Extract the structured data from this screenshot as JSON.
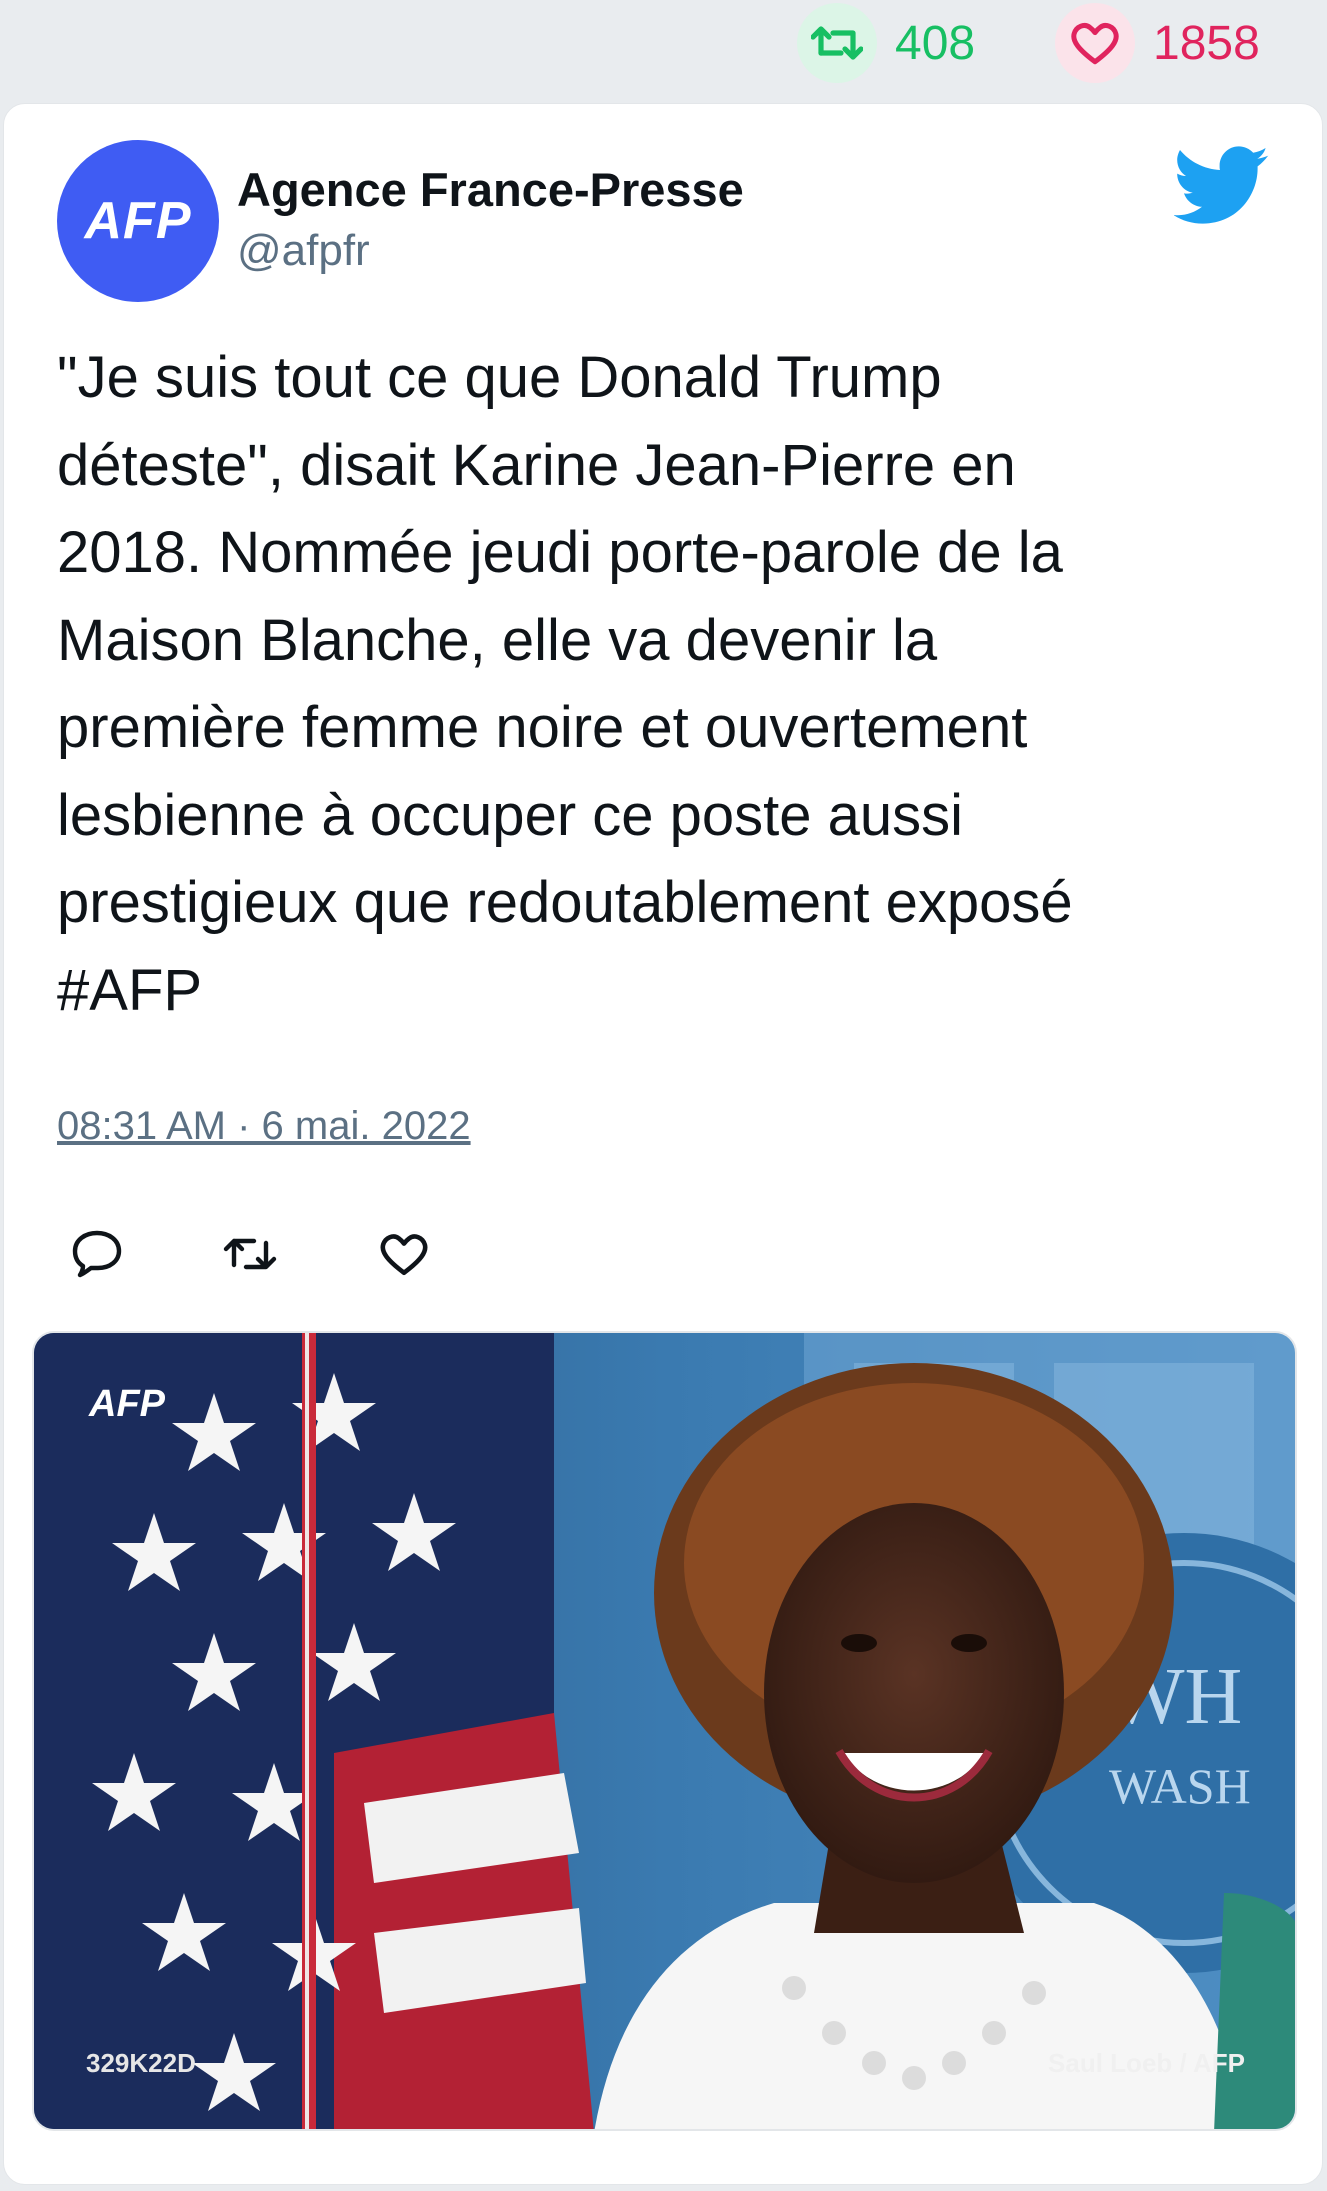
{
  "stats": {
    "retweets": "408",
    "likes": "1858"
  },
  "tweet": {
    "author_name": "Agence France-Presse",
    "handle": "@afpfr",
    "avatar_text": "AFP",
    "text": "\"Je suis tout ce que Donald Trump\ndéteste\", disait Karine Jean-Pierre en\n2018. Nommée jeudi porte-parole de la\nMaison Blanche, elle va devenir la\npremière femme noire et ouvertement\nlesbienne à occuper ce poste aussi\nprestigieux que redoutablement exposé\n#AFP",
    "timestamp": "08:31 AM · 6 mai. 2022"
  },
  "media": {
    "watermark": "AFP",
    "photo_code": "329K22D",
    "credit": "Saul Loeb / AFP",
    "background_sign": "WH\nWASH"
  },
  "icons": {
    "retweet": "retweet-icon",
    "like": "heart-icon",
    "reply": "reply-icon",
    "brand": "twitter-bird-icon"
  },
  "colors": {
    "retweet": "#17bf63",
    "like": "#e0245e",
    "twitter_blue": "#1da1f2",
    "avatar_bg": "#3f5cf3"
  }
}
